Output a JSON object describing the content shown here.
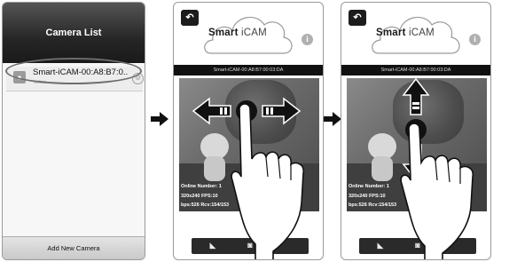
{
  "camera_list": {
    "title": "Camera List",
    "camera": {
      "name": "Smart-iCAM-00:A8:B7:0..",
      "status": "online"
    },
    "add_button": "Add New Camera"
  },
  "viewer": {
    "logo_brand": "Smart",
    "logo_product": "iCAM",
    "back_glyph": "↶",
    "info_glyph": "i",
    "panel2_camera_id": "Smart-iCAM-00:A8:B7:00:03:DA",
    "panel3_camera_id": "Smart-iCAM-00:A8:B7:00:03:DA",
    "stats_online": "Online Number: 1",
    "stats_res": "320x240  FPS:10",
    "stats_bps": "bps:526  Rcv:154/153"
  },
  "icons": {
    "back": "back-arrow-icon",
    "info": "info-icon",
    "settings": "gear-icon",
    "camera": "camera-icon",
    "flow": "arrow-right-icon",
    "pan": "pan-horizontal-icon",
    "tilt": "tilt-vertical-icon"
  },
  "colors": {
    "header_dark": "#262626",
    "screen_bg": "#f2f2f2",
    "accent_gray": "#6d6d6d"
  }
}
